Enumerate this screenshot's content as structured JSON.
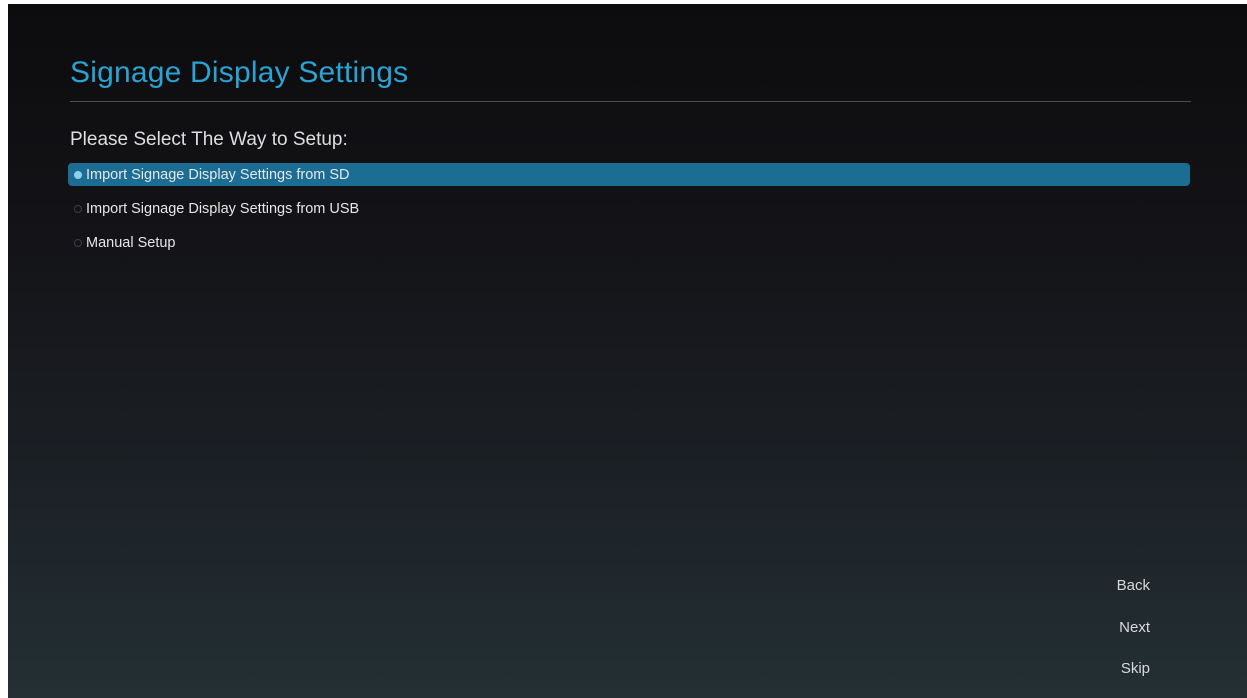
{
  "header": {
    "title": "Signage Display Settings"
  },
  "setup": {
    "prompt": "Please Select The Way to Setup:",
    "selected_index": 0,
    "options": [
      {
        "label": "Import Signage Display Settings from SD",
        "selected": true
      },
      {
        "label": "Import Signage Display Settings from USB",
        "selected": false
      },
      {
        "label": "Manual Setup",
        "selected": false
      }
    ]
  },
  "navigation": {
    "back_label": "Back",
    "next_label": "Next",
    "skip_label": "Skip"
  },
  "colors": {
    "title": "#2aa3d3",
    "selection_highlight": "#1b6d93",
    "text": "#e6e6e6"
  }
}
